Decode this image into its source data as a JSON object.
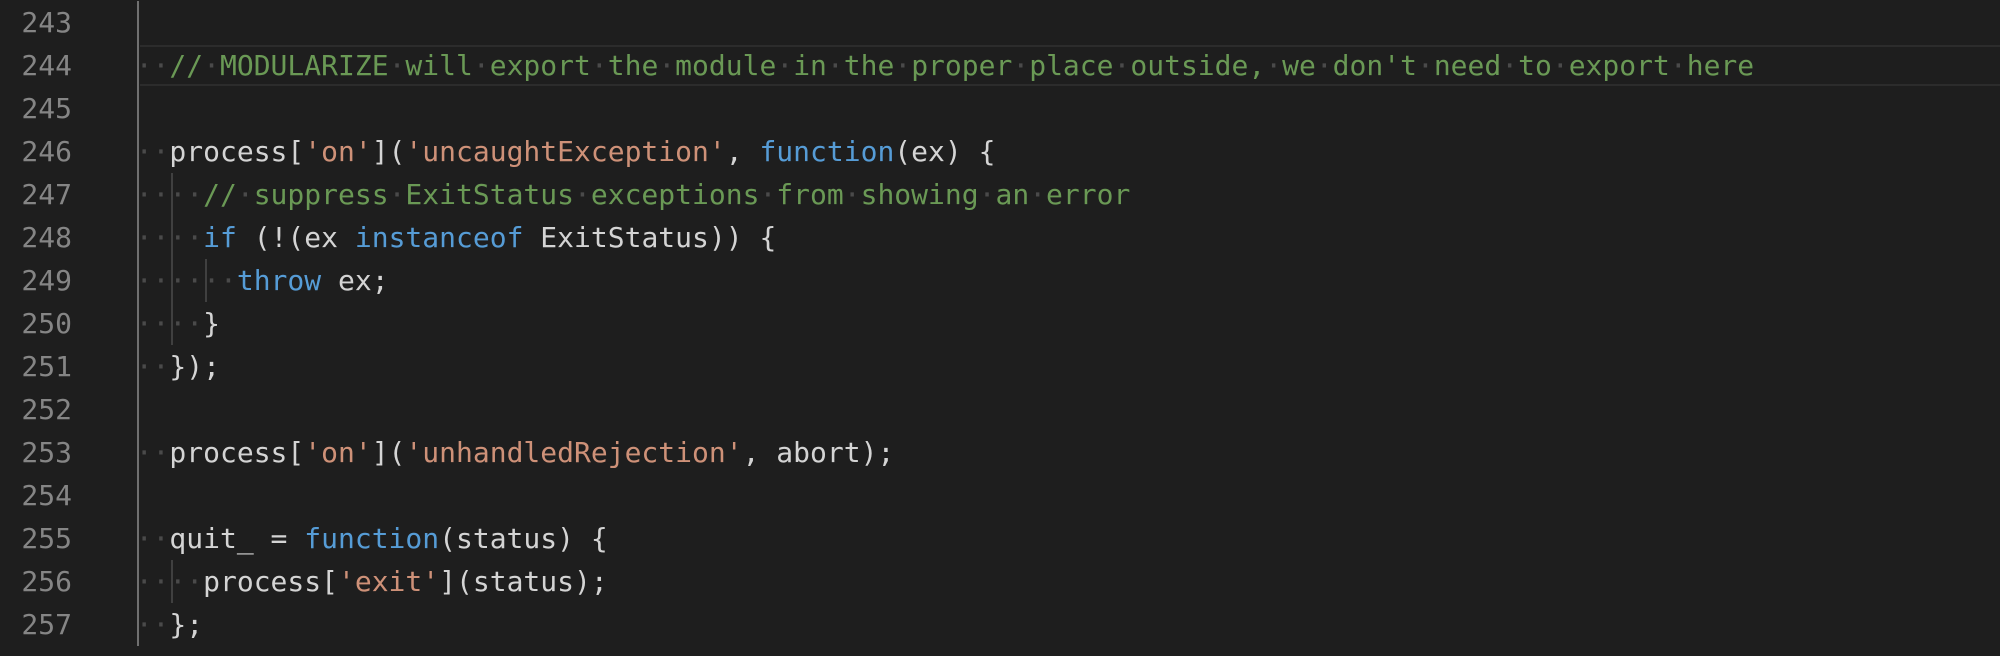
{
  "editor": {
    "lines": [
      {
        "n": "243",
        "indent": 0,
        "tokens": []
      },
      {
        "n": "244",
        "indent": 1,
        "current": true,
        "tokens": [
          {
            "t": "com",
            "s": "// MODULARIZE will export the module in the proper place outside, we don't need to export here"
          }
        ]
      },
      {
        "n": "245",
        "indent": 0,
        "tokens": []
      },
      {
        "n": "246",
        "indent": 1,
        "tokens": [
          {
            "t": "plain",
            "s": "process["
          },
          {
            "t": "str",
            "s": "'on'"
          },
          {
            "t": "plain",
            "s": "]("
          },
          {
            "t": "str",
            "s": "'uncaughtException'"
          },
          {
            "t": "plain",
            "s": ", "
          },
          {
            "t": "kw",
            "s": "function"
          },
          {
            "t": "plain",
            "s": "(ex) {"
          }
        ]
      },
      {
        "n": "247",
        "indent": 2,
        "tokens": [
          {
            "t": "com",
            "s": "// suppress ExitStatus exceptions from showing an error"
          }
        ]
      },
      {
        "n": "248",
        "indent": 2,
        "tokens": [
          {
            "t": "kw",
            "s": "if"
          },
          {
            "t": "plain",
            "s": " (!(ex "
          },
          {
            "t": "kw",
            "s": "instanceof"
          },
          {
            "t": "plain",
            "s": " ExitStatus)) {"
          }
        ]
      },
      {
        "n": "249",
        "indent": 3,
        "tokens": [
          {
            "t": "kw",
            "s": "throw"
          },
          {
            "t": "plain",
            "s": " ex;"
          }
        ]
      },
      {
        "n": "250",
        "indent": 2,
        "tokens": [
          {
            "t": "plain",
            "s": "}"
          }
        ]
      },
      {
        "n": "251",
        "indent": 1,
        "tokens": [
          {
            "t": "plain",
            "s": "});"
          }
        ]
      },
      {
        "n": "252",
        "indent": 0,
        "tokens": []
      },
      {
        "n": "253",
        "indent": 1,
        "tokens": [
          {
            "t": "plain",
            "s": "process["
          },
          {
            "t": "str",
            "s": "'on'"
          },
          {
            "t": "plain",
            "s": "]("
          },
          {
            "t": "str",
            "s": "'unhandledRejection'"
          },
          {
            "t": "plain",
            "s": ", abort);"
          }
        ]
      },
      {
        "n": "254",
        "indent": 0,
        "tokens": []
      },
      {
        "n": "255",
        "indent": 1,
        "tokens": [
          {
            "t": "plain",
            "s": "quit_ = "
          },
          {
            "t": "kw",
            "s": "function"
          },
          {
            "t": "plain",
            "s": "(status) {"
          }
        ]
      },
      {
        "n": "256",
        "indent": 2,
        "tokens": [
          {
            "t": "plain",
            "s": "process["
          },
          {
            "t": "str",
            "s": "'exit'"
          },
          {
            "t": "plain",
            "s": "](status);"
          }
        ]
      },
      {
        "n": "257",
        "indent": 1,
        "tokens": [
          {
            "t": "plain",
            "s": "};"
          }
        ]
      }
    ]
  },
  "colors": {
    "background": "#1e1e1e",
    "line_number": "#858585",
    "plain": "#d4d4d4",
    "string": "#ce9178",
    "keyword": "#569cd6",
    "comment": "#6a9955",
    "whitespace_dot": "#4a4a4a"
  }
}
